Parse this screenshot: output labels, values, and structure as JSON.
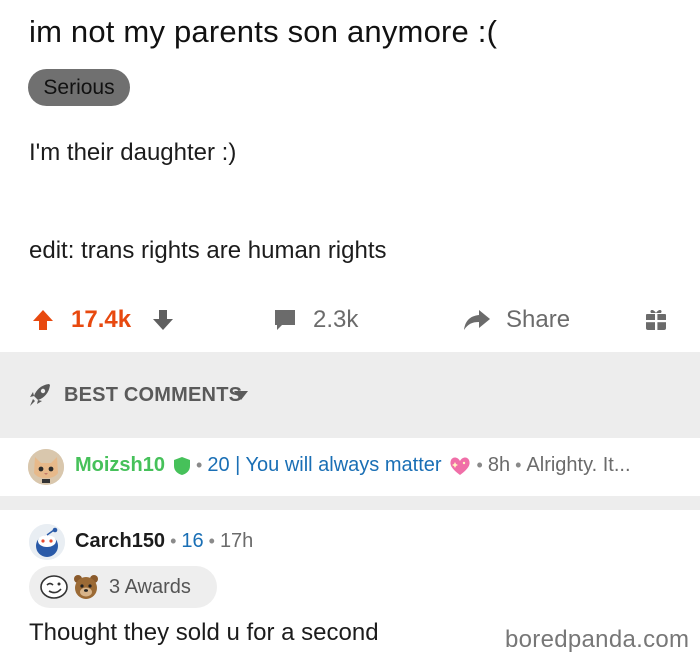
{
  "post": {
    "title": "im not my parents son anymore :(",
    "flair": "Serious",
    "body_line_1": "I'm their daughter  :)",
    "body_line_2": "edit: trans rights are human rights"
  },
  "actions": {
    "upvote_count": "17.4k",
    "comment_count": "2.3k",
    "share_label": "Share"
  },
  "sort": {
    "label": "BEST COMMENTS"
  },
  "comments": [
    {
      "username": "Moizsh10",
      "user_flair": "20 | You will always matter",
      "age": "8h",
      "preview": "Alrighty. It..."
    },
    {
      "username": "Carch150",
      "score": "16",
      "age": "17h",
      "awards_label": "3 Awards",
      "text": "Thought they sold u for a second"
    }
  ],
  "watermark": "boredpanda.com",
  "colors": {
    "upvote_orange": "#e8490f",
    "flair_gray": "#707070",
    "username_green": "#46c15a",
    "link_blue": "#1a6fb5",
    "separator_gray": "#ededed"
  },
  "icons": [
    "upvote-arrow-icon",
    "downvote-arrow-icon",
    "comment-bubble-icon",
    "share-arrow-icon",
    "gift-icon",
    "rocket-icon",
    "caret-down-icon",
    "shield-icon",
    "sparkle-heart-icon"
  ]
}
